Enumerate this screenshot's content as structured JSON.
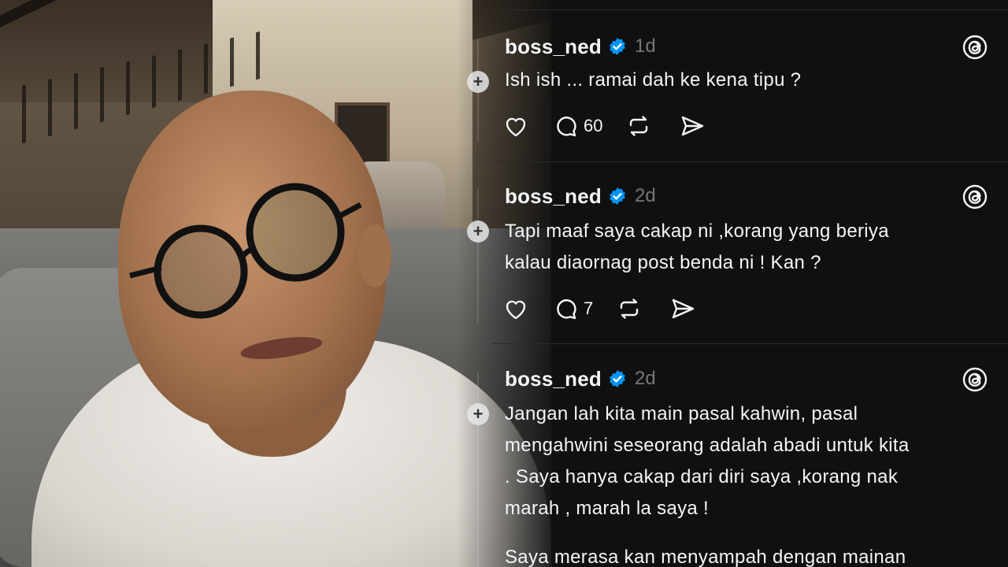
{
  "posts": [
    {
      "username": "boss_ned",
      "time": "1d",
      "lines": [
        "Ish ish ... ramai dah ke kena tipu ?"
      ],
      "reply_count": "60"
    },
    {
      "username": "boss_ned",
      "time": "2d",
      "lines": [
        "Tapi maaf saya cakap ni ,korang yang beriya",
        "kalau diaornag post benda ni ! Kan ?"
      ],
      "reply_count": "7"
    },
    {
      "username": "boss_ned",
      "time": "2d",
      "lines": [
        "Jangan lah kita main pasal kahwin, pasal",
        "mengahwini seseorang adalah abadi untuk kita",
        ". Saya hanya cakap dari diri saya ,korang nak",
        "marah , marah la saya !"
      ],
      "lines2": [
        "Saya merasa kan menyampah dengan mainan"
      ]
    }
  ],
  "colors": {
    "verified": "#0095f6",
    "background": "#101010",
    "muted": "#777777"
  },
  "icons": [
    "verified-badge-icon",
    "threads-logo-icon",
    "heart-icon",
    "comment-icon",
    "repost-icon",
    "share-icon",
    "add-icon"
  ]
}
